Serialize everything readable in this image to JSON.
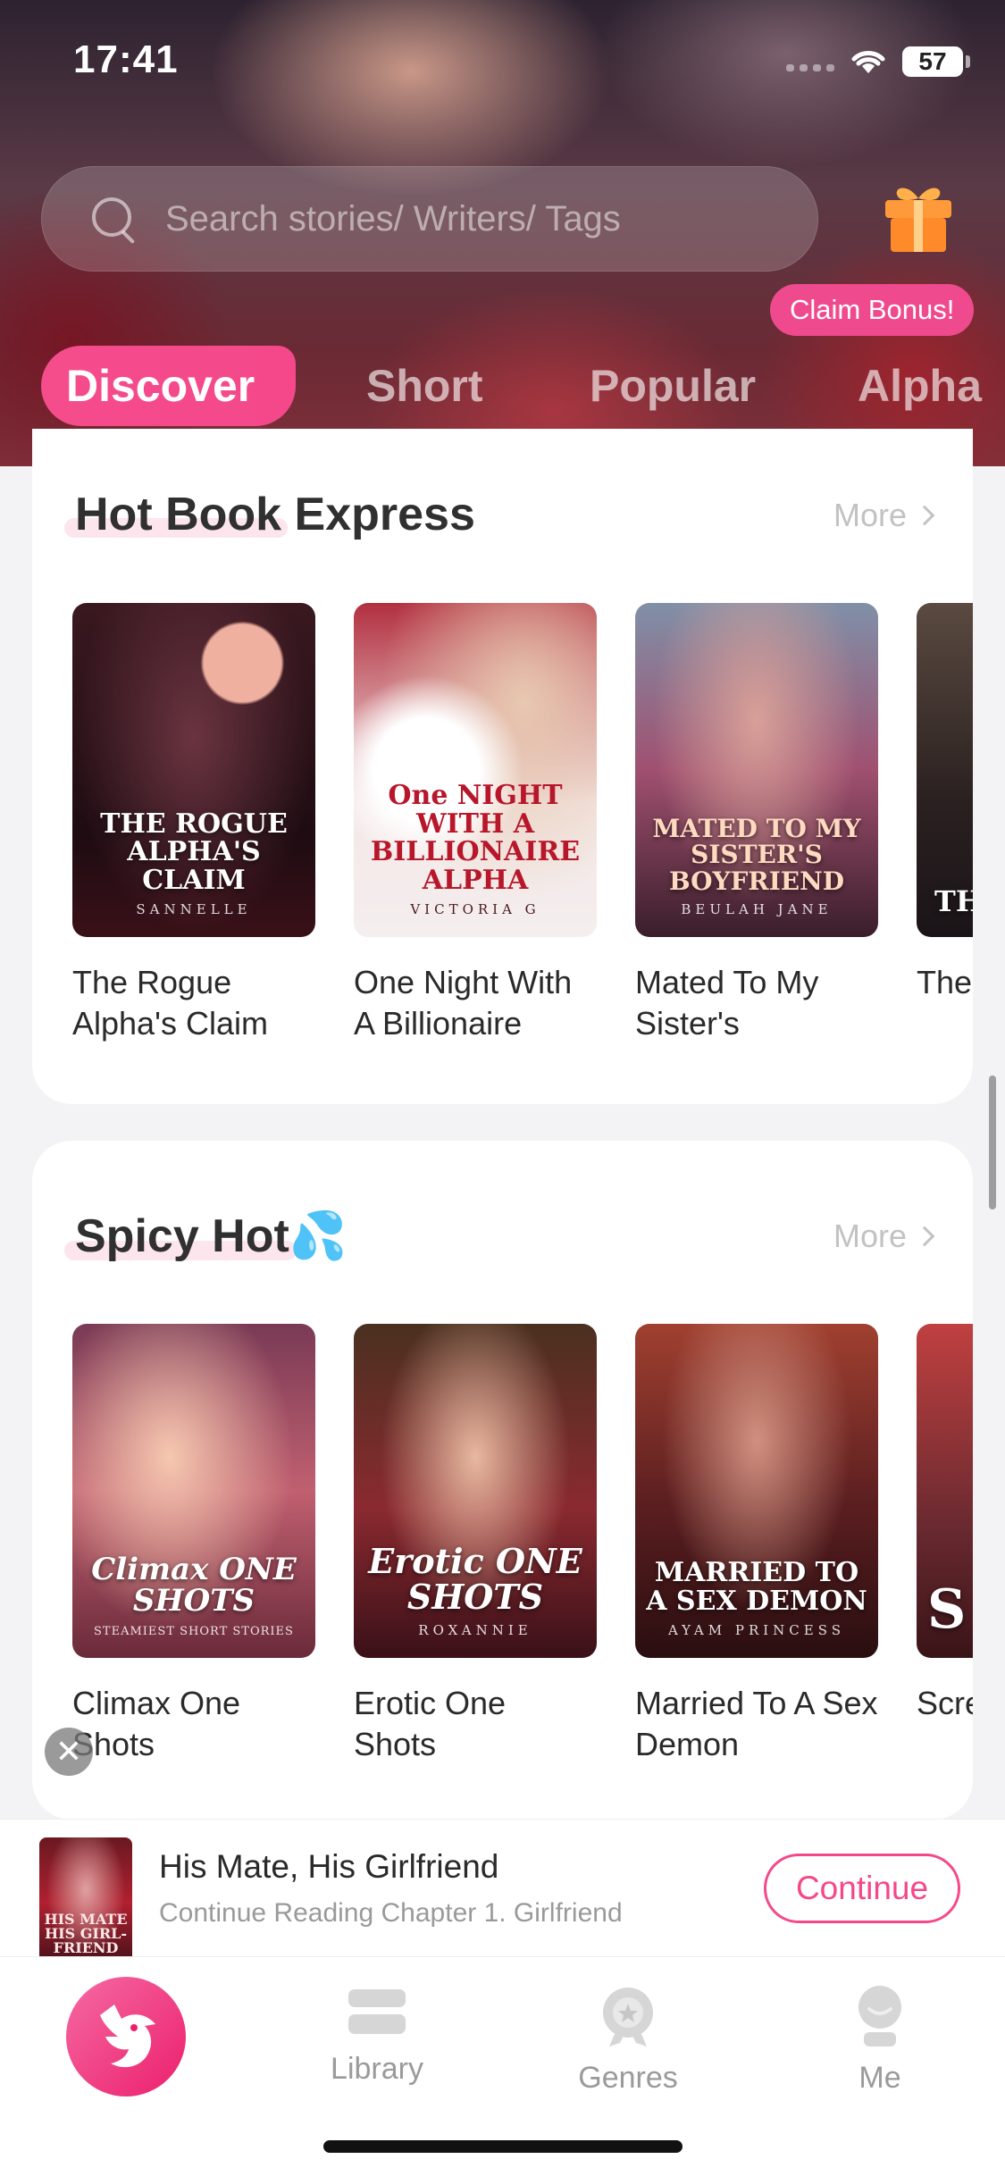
{
  "status_bar": {
    "time": "17:41",
    "battery": "57"
  },
  "search": {
    "placeholder": "Search stories/ Writers/ Tags"
  },
  "claim_bonus": "Claim Bonus!",
  "tabs": [
    {
      "label": "Discover",
      "active": true
    },
    {
      "label": "Short"
    },
    {
      "label": "Popular"
    },
    {
      "label": "Alpha"
    }
  ],
  "sections": {
    "hot": {
      "title": "Hot Book Express",
      "more": "More",
      "books": [
        {
          "title": "The Rogue Alpha's Claim",
          "cover_title": "THE ROGUE ALPHA'S CLAIM",
          "cover_author": "SANNELLE"
        },
        {
          "title": "One Night With A Billionaire",
          "cover_title": "One NIGHT WITH A BILLIONAIRE ALPHA",
          "cover_author": "VICTORIA G"
        },
        {
          "title": "Mated To My Sister's",
          "cover_title": "MATED TO MY SISTER'S BOYFRIEND",
          "cover_author": "BEULAH JANE"
        },
        {
          "title": "The Ex-wife",
          "cover_title": "TH EX-",
          "cover_author": ""
        }
      ]
    },
    "spicy": {
      "title": "Spicy Hot",
      "emoji": "💦",
      "more": "More",
      "books": [
        {
          "title": "Climax One Shots",
          "cover_title": "Climax ONE SHOTS",
          "cover_author": "STEAMIEST SHORT STORIES"
        },
        {
          "title": "Erotic One Shots",
          "cover_title": "Erotic ONE SHOTS",
          "cover_author": "ROXANNIE"
        },
        {
          "title": "Married To A Sex Demon",
          "cover_title": "MARRIED TO A SEX DEMON",
          "cover_author": "AYAM PRINCESS"
        },
        {
          "title": "Scre",
          "cover_title": "S",
          "cover_author": ""
        }
      ]
    }
  },
  "continue_reading": {
    "title": "His Mate, His Girlfriend",
    "subtitle": "Continue Reading Chapter 1. Girlfriend",
    "button": "Continue",
    "cover_title": "HIS MATE HIS GIRL-FRIEND"
  },
  "tabbar": {
    "library": "Library",
    "genres": "Genres",
    "me": "Me"
  },
  "colors": {
    "accent": "#f4488a",
    "more_gray": "#c2c2c2"
  }
}
